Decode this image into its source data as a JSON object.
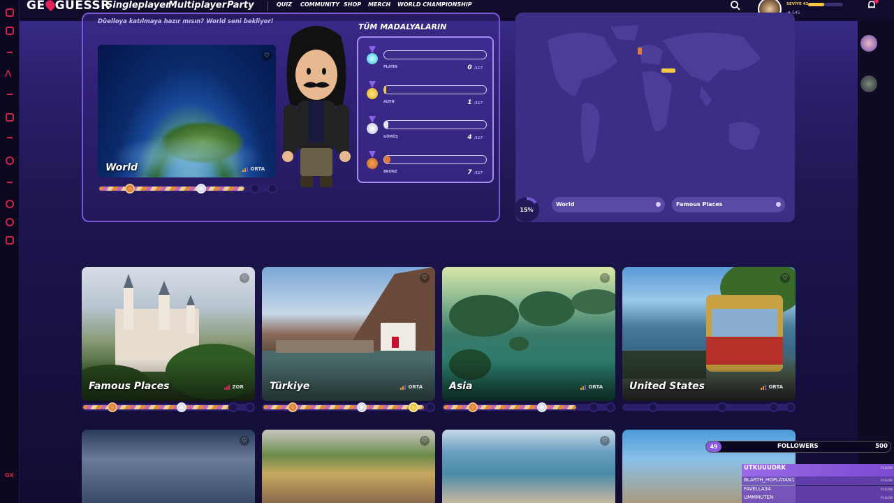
{
  "header": {
    "logo": "GE GUESSR",
    "nav_main": [
      "Singleplayer",
      "Multiplayer",
      "Party"
    ],
    "nav_small": [
      "QUIZ",
      "COMMUNITY",
      "SHOP",
      "MERCH",
      "WORLD CHAMPIONSHIP"
    ],
    "level_label": "SEVİYE 43",
    "coins": "545",
    "icons": [
      "search-icon",
      "bell-icon",
      "avatar"
    ]
  },
  "left_strip": {
    "label": "GX"
  },
  "featured": {
    "subtitle": "Düelloya katılmaya hazır mısın? World seni bekliyor!",
    "map_title": "World",
    "difficulty": "ORTA"
  },
  "medals": {
    "title": "TÜM MADALYALARIN",
    "rows": [
      {
        "name": "PLATİN",
        "count": "0",
        "total": "/117",
        "fraction": 0.0
      },
      {
        "name": "ALTIN",
        "count": "1",
        "total": "/117",
        "fraction": 0.01
      },
      {
        "name": "GÜMÜŞ",
        "count": "4",
        "total": "/117",
        "fraction": 0.034
      },
      {
        "name": "BRONZ",
        "count": "7",
        "total": "/117",
        "fraction": 0.06
      }
    ]
  },
  "map_panel": {
    "percent": "15%",
    "chips": [
      "World",
      "Famous Places"
    ]
  },
  "cards": [
    {
      "title": "Famous Places",
      "difficulty": "ZOR"
    },
    {
      "title": "Türkiye",
      "difficulty": "ORTA"
    },
    {
      "title": "Asia",
      "difficulty": "ORTA"
    },
    {
      "title": "United States",
      "difficulty": "ORTA"
    }
  ],
  "followers": {
    "current": "49",
    "label": "FOLLOWERS",
    "goal": "500",
    "list": [
      "UTKUUUDRK",
      "BLARTH_HOPLATAN1",
      "FAVELLA34",
      "UMMMUTEN"
    ],
    "follow_label": "FOLLOW"
  },
  "colors": {
    "accent": "#7a56d8",
    "brand_red": "#e0245a",
    "gold": "#f6c744"
  }
}
